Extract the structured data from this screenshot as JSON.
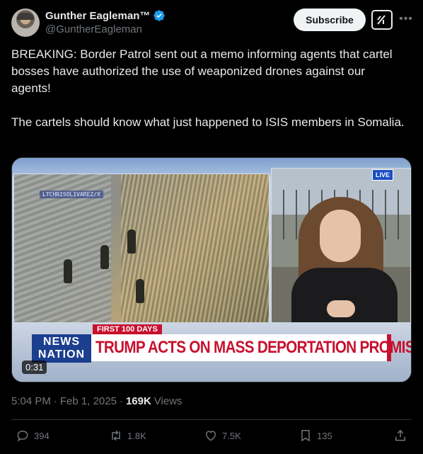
{
  "author": {
    "display_name": "Gunther Eagleman™",
    "handle": "@GuntherEagleman",
    "verified": true
  },
  "header": {
    "subscribe_label": "Subscribe",
    "grok_icon": "grok-icon",
    "more_icon": "more-icon"
  },
  "tweet": {
    "text": "BREAKING: Border Patrol sent out a memo informing agents that cartel bosses have authorized the use of weaponized drones against our agents!\n\nThe cartels should know what just happened to ISIS members in Somalia."
  },
  "media": {
    "watermark": "LTCHRISOLIVAREZ/X",
    "live_label": "LIVE",
    "tag": "FIRST 100 DAYS",
    "network_line1": "NEWS",
    "network_line2": "NATION",
    "headline": "TRUMP ACTS ON MASS DEPORTATION PROMISE",
    "duration": "0:31"
  },
  "meta": {
    "time": "5:04 PM",
    "separator": "·",
    "date": "Feb 1, 2025",
    "views_count": "169K",
    "views_label": "Views"
  },
  "actions": {
    "replies": "394",
    "reposts": "1.8K",
    "likes": "7.5K",
    "bookmarks": "135"
  },
  "colors": {
    "background": "#000000",
    "text": "#e7e9ea",
    "secondary": "#71767b",
    "verified_blue": "#1d9bf0",
    "headline_red": "#c8102e"
  }
}
